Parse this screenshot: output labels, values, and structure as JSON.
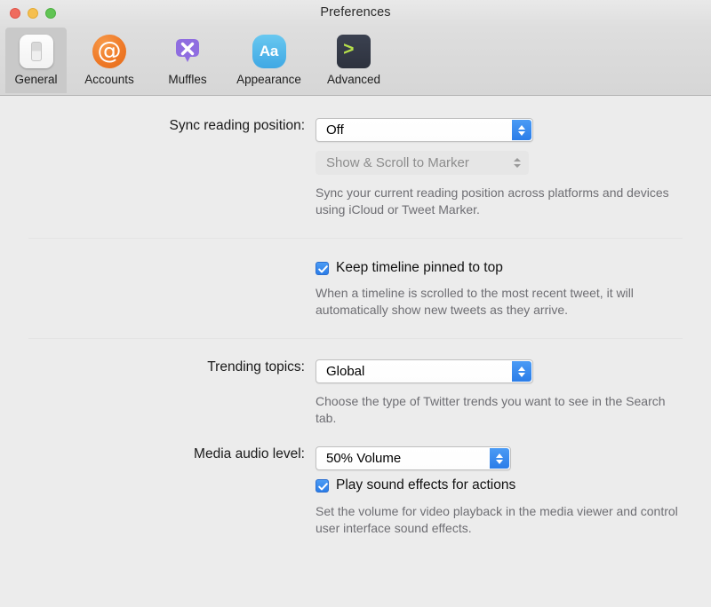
{
  "window": {
    "title": "Preferences",
    "traffic_lights": [
      "close",
      "minimize",
      "maximize"
    ]
  },
  "toolbar": {
    "tabs": [
      {
        "label": "General",
        "icon": "toggle-switch-icon",
        "selected": true
      },
      {
        "label": "Accounts",
        "icon": "at-sign-icon",
        "selected": false
      },
      {
        "label": "Muffles",
        "icon": "speech-bubble-x-icon",
        "selected": false
      },
      {
        "label": "Appearance",
        "icon": "font-aa-icon",
        "selected": false
      },
      {
        "label": "Advanced",
        "icon": "terminal-prompt-icon",
        "selected": false
      }
    ]
  },
  "settings": {
    "sync_reading_position": {
      "label": "Sync reading position:",
      "value": "Off",
      "secondary_value": "Show & Scroll to Marker",
      "secondary_disabled": true,
      "help": "Sync your current reading position across platforms and devices using iCloud or Tweet Marker."
    },
    "keep_timeline_pinned": {
      "label": "Keep timeline pinned to top",
      "checked": true,
      "help": "When a timeline is scrolled to the most recent tweet, it will automatically show new tweets as they arrive."
    },
    "trending_topics": {
      "label": "Trending topics:",
      "value": "Global",
      "help": "Choose the type of Twitter trends you want to see in the Search tab."
    },
    "media_audio_level": {
      "label": "Media audio level:",
      "value": "50% Volume",
      "checkbox_label": "Play sound effects for actions",
      "checkbox_checked": true,
      "help": "Set the volume for video playback in the media viewer and control user interface sound effects."
    }
  },
  "icons": {
    "at_glyph": "@",
    "aa_glyph": "Aa",
    "terminal_glyph": ">",
    "muffles_glyph": "✕"
  },
  "colors": {
    "accent": "#2b7de8",
    "window_bg": "#ececec",
    "toolbar_bg": "#dedede",
    "help_text": "#6e6e73"
  }
}
